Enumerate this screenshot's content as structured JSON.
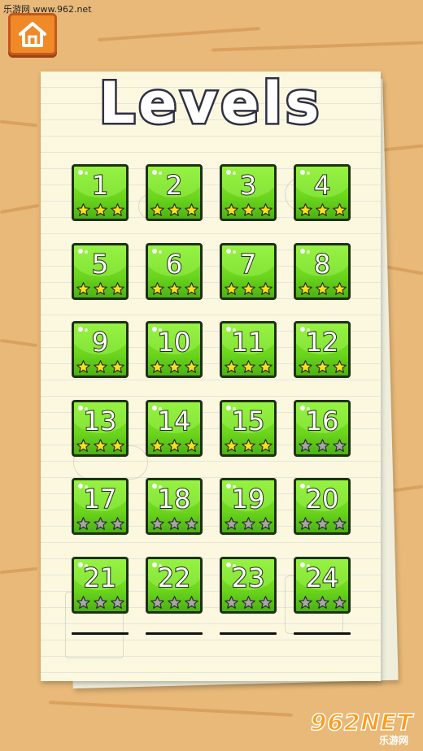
{
  "watermark": {
    "top_text": "乐游网 www.962.net",
    "logo_main": "962NET",
    "logo_sub": "乐游网"
  },
  "header": {
    "title": "Levels",
    "home_icon": "home-icon"
  },
  "colors": {
    "tile_green": "#6bd51d",
    "star_earned": "#f6e21a",
    "star_locked": "#a7a7a7",
    "home_orange": "#f08a28"
  },
  "levels": [
    {
      "number": "1",
      "stars": 3
    },
    {
      "number": "2",
      "stars": 3
    },
    {
      "number": "3",
      "stars": 3
    },
    {
      "number": "4",
      "stars": 3
    },
    {
      "number": "5",
      "stars": 3
    },
    {
      "number": "6",
      "stars": 3
    },
    {
      "number": "7",
      "stars": 3
    },
    {
      "number": "8",
      "stars": 3
    },
    {
      "number": "9",
      "stars": 3
    },
    {
      "number": "10",
      "stars": 3
    },
    {
      "number": "11",
      "stars": 3
    },
    {
      "number": "12",
      "stars": 3
    },
    {
      "number": "13",
      "stars": 3
    },
    {
      "number": "14",
      "stars": 3
    },
    {
      "number": "15",
      "stars": 3
    },
    {
      "number": "16",
      "stars": 0
    },
    {
      "number": "17",
      "stars": 0
    },
    {
      "number": "18",
      "stars": 0
    },
    {
      "number": "19",
      "stars": 0
    },
    {
      "number": "20",
      "stars": 0
    },
    {
      "number": "21",
      "stars": 0
    },
    {
      "number": "22",
      "stars": 0
    },
    {
      "number": "23",
      "stars": 0
    },
    {
      "number": "24",
      "stars": 0
    }
  ]
}
